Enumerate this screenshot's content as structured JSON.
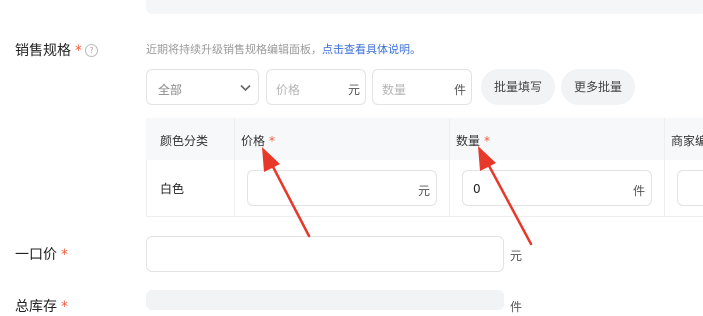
{
  "sale_spec": {
    "label": "销售规格",
    "required_mark": "*",
    "help_icon": "?",
    "tip_text": "近期将持续升级销售规格编辑面板，",
    "tip_link": "点击查看具体说明",
    "tip_end": "。"
  },
  "batch": {
    "select_value": "全部",
    "price_placeholder": "价格",
    "price_unit": "元",
    "qty_placeholder": "数量",
    "qty_unit": "件",
    "fill_button": "批量填写",
    "more_button": "更多批量"
  },
  "table": {
    "headers": [
      "颜色分类",
      "价格",
      "数量",
      "商家编"
    ],
    "required_mark": "*",
    "rows": [
      {
        "color": "白色",
        "price": "",
        "price_unit": "元",
        "qty": "0",
        "qty_unit": "件"
      }
    ]
  },
  "one_price": {
    "label": "一口价",
    "required_mark": "*",
    "value": "",
    "unit": "元"
  },
  "stock": {
    "label": "总库存",
    "required_mark": "*",
    "unit": "件"
  },
  "colors": {
    "required": "#f25a3c",
    "link": "#3a6fd8",
    "arrow": "#e8382a"
  }
}
